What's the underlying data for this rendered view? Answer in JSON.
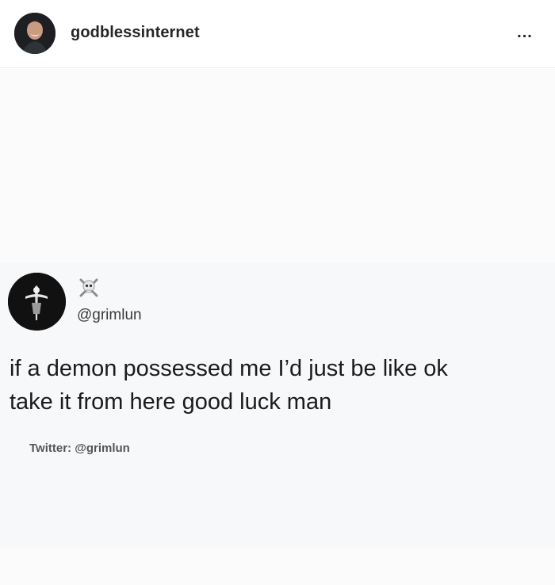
{
  "header": {
    "username": "godblessinternet",
    "more_label": "..."
  },
  "tweet": {
    "handle": "@grimlun",
    "text": "if a demon possessed me I’d just be like ok\ntake it from here good luck man",
    "credit": "Twitter: @grimlun",
    "emoji_icon": "skull-crossbones-icon"
  }
}
